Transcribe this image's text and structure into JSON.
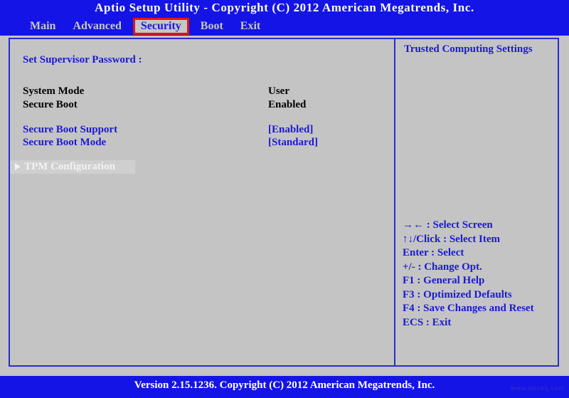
{
  "header": {
    "title": "Aptio Setup Utility - Copyright (C) 2012 American Megatrends,  Inc.",
    "menu": [
      {
        "label": "Main",
        "active": false
      },
      {
        "label": "Advanced",
        "active": false
      },
      {
        "label": "Security",
        "active": true
      },
      {
        "label": "Boot",
        "active": false
      },
      {
        "label": "Exit",
        "active": false
      }
    ]
  },
  "main": {
    "rows": [
      {
        "label": "Set Supervisor Password :",
        "value": "",
        "label_color": "blue",
        "value_color": "blue",
        "selected": false,
        "submenu": false
      },
      {
        "label": "System Mode",
        "value": "User",
        "label_color": "black",
        "value_color": "black",
        "selected": false,
        "submenu": false
      },
      {
        "label": "Secure Boot",
        "value": "Enabled",
        "label_color": "black",
        "value_color": "black",
        "selected": false,
        "submenu": false
      },
      {
        "label": "Secure Boot Support",
        "value": "[Enabled]",
        "label_color": "blue",
        "value_color": "blue",
        "selected": false,
        "submenu": false
      },
      {
        "label": "Secure Boot Mode",
        "value": "[Standard]",
        "label_color": "blue",
        "value_color": "blue",
        "selected": false,
        "submenu": false
      },
      {
        "label": "TPM Configuration",
        "value": "",
        "label_color": "white",
        "value_color": "white",
        "selected": true,
        "submenu": true
      }
    ]
  },
  "help": {
    "title": "Trusted Computing Settings",
    "legend": [
      "→← : Select Screen",
      "↑↓/Click : Select Item",
      "Enter : Select",
      "+/- : Change Opt.",
      "F1 : General Help",
      "F3 : Optimized Defaults",
      "F4 : Save Changes and Reset",
      "ECS : Exit"
    ]
  },
  "footer": {
    "version": "Version 2.15.1236.  Copyright (C) 2012 American Megatrends,  Inc.",
    "watermark": "www.devaq.com"
  },
  "colors": {
    "bios_blue": "#1414e6",
    "panel_gray": "#c4c4c4",
    "text_blue": "#1a1ad2",
    "active_tab_border": "#e01414",
    "border_blue": "#2a2ad8"
  }
}
